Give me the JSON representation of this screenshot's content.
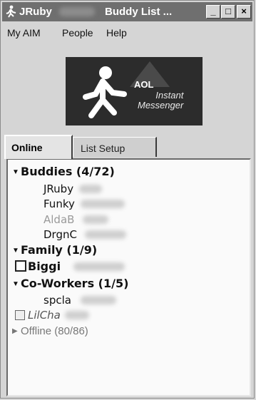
{
  "window": {
    "title_left": "JRuby",
    "title_right": "Buddy List ...",
    "buttons": {
      "minimize": "_",
      "maximize": "□",
      "close": "×"
    }
  },
  "menu": {
    "items": [
      "My AIM",
      "People",
      "Help"
    ]
  },
  "banner": {
    "line1": "AOL",
    "line2": "Instant",
    "line3": "Messenger"
  },
  "tabs": {
    "online": "Online",
    "setup": "List Setup"
  },
  "groups": {
    "buddies": {
      "label": "Buddies (4/72)",
      "members": [
        "JRuby",
        "Funky",
        "AldaB",
        "DrgnC"
      ]
    },
    "family": {
      "label": "Family (1/9)",
      "members": [
        "Biggi"
      ]
    },
    "coworkers": {
      "label": "Co-Workers (1/5)",
      "members": [
        "spcla",
        "LilCha"
      ]
    },
    "offline": {
      "label": "Offline (80/86)"
    }
  }
}
